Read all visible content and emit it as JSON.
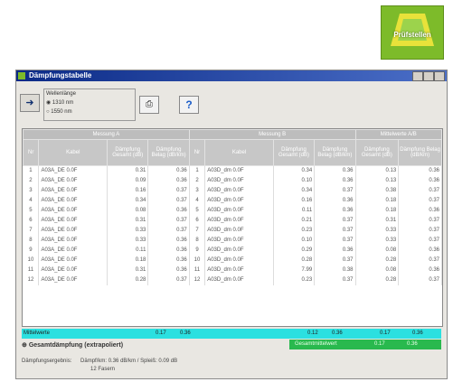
{
  "logo": {
    "text": "Prüfstellen"
  },
  "window": {
    "title": "Dämpfungstabelle"
  },
  "toolbar": {
    "back_icon": "back-arrow-icon",
    "radio_title": "Wellenlänge",
    "radio1": "1310 nm",
    "radio2": "1550 nm",
    "print_icon": "printer-icon",
    "help_label": "?"
  },
  "table": {
    "group_headers": [
      "Messung A",
      "Messung B",
      "Mittelwerte A/B"
    ],
    "sub_headers": [
      "Nr",
      "Kabel",
      "Dämpfung Gesamt (dB)",
      "Dämpfung Belag (dB/km)",
      "Nr",
      "Kabel",
      "Dämpfung Gesamt (dB)",
      "Dämpfung Belag (dB/km)",
      "Dämpfung Gesamt (dB)",
      "Dämpfung Belag (dB/km)"
    ],
    "rows": [
      [
        "1",
        "A03A_DE 0.0F",
        "0.31",
        "0.36",
        "1",
        "A03D_dm 0.0F",
        "0.34",
        "0.36",
        "0.13",
        "0.36"
      ],
      [
        "2",
        "A03A_DE 0.0F",
        "0.09",
        "0.36",
        "2",
        "A03D_dm 0.0F",
        "0.10",
        "0.36",
        "0.13",
        "0.36"
      ],
      [
        "3",
        "A03A_DE 0.0F",
        "0.16",
        "0.37",
        "3",
        "A03D_dm 0.0F",
        "0.34",
        "0.37",
        "0.38",
        "0.37"
      ],
      [
        "4",
        "A03A_DE 0.0F",
        "0.34",
        "0.37",
        "4",
        "A03D_dm 0.0F",
        "0.16",
        "0.36",
        "0.18",
        "0.37"
      ],
      [
        "5",
        "A03A_DE 0.0F",
        "0.08",
        "0.36",
        "5",
        "A03D_dm 0.0F",
        "0.11",
        "0.36",
        "0.18",
        "0.36"
      ],
      [
        "6",
        "A03A_DE 0.0F",
        "0.31",
        "0.37",
        "6",
        "A03D_dm 0.0F",
        "0.21",
        "0.37",
        "0.31",
        "0.37"
      ],
      [
        "7",
        "A03A_DE 0.0F",
        "0.33",
        "0.37",
        "7",
        "A03D_dm 0.0F",
        "0.23",
        "0.37",
        "0.33",
        "0.37"
      ],
      [
        "8",
        "A03A_DE 0.0F",
        "0.33",
        "0.36",
        "8",
        "A03D_dm 0.0F",
        "0.10",
        "0.37",
        "0.33",
        "0.37"
      ],
      [
        "9",
        "A03A_DE 0.0F",
        "0.11",
        "0.36",
        "9",
        "A03D_dm 0.0F",
        "0.29",
        "0.36",
        "0.08",
        "0.36"
      ],
      [
        "10",
        "A03A_DE 0.0F",
        "0.18",
        "0.36",
        "10",
        "A03D_dm 0.0F",
        "0.28",
        "0.37",
        "0.28",
        "0.37"
      ],
      [
        "11",
        "A03A_DE 0.0F",
        "0.31",
        "0.36",
        "11",
        "A03D_dm 0.0F",
        "7.99",
        "0.38",
        "0.08",
        "0.36"
      ],
      [
        "12",
        "A03A_DE 0.0F",
        "0.28",
        "0.37",
        "12",
        "A03D_dm 0.0F",
        "0.23",
        "0.37",
        "0.28",
        "0.37"
      ]
    ]
  },
  "mittelwerte": {
    "label": "Mittelwerte",
    "a_ges": "0.17",
    "a_bel": "0.36",
    "b_ges": "0.12",
    "b_bel": "0.36",
    "m_ges": "0.17",
    "m_bel": "0.36"
  },
  "gesamt": {
    "label": "Gesamtdämpfung (extrapoliert)",
    "green_label": "Gesamtmittelwert",
    "val1": "0.17",
    "val2": "0.36"
  },
  "ergebnis": {
    "label": "Dämpfungsergebnis:",
    "line1": "Dämpf/km: 0.36 dB/km  /  Spleiß: 0.09 dB",
    "line2": "12 Fasern"
  }
}
